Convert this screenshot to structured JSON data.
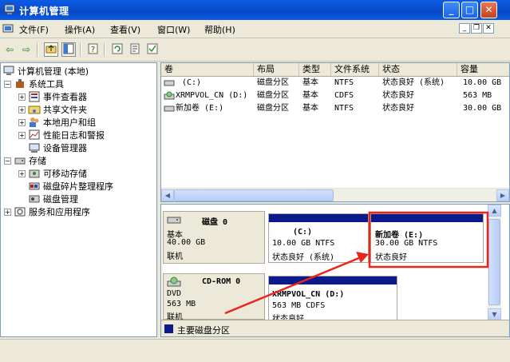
{
  "window": {
    "title": "计算机管理"
  },
  "menu": {
    "items": [
      "文件(F)",
      "操作(A)",
      "查看(V)",
      "窗口(W)",
      "帮助(H)"
    ]
  },
  "tree": {
    "root": "计算机管理 (本地)",
    "system_tools": "系统工具",
    "event_viewer": "事件查看器",
    "shared_folders": "共享文件夹",
    "local_users": "本地用户和组",
    "perf_logs": "性能日志和警报",
    "device_manager": "设备管理器",
    "storage": "存储",
    "removable": "可移动存储",
    "defrag": "磁盘碎片整理程序",
    "disk_mgmt": "磁盘管理",
    "services": "服务和应用程序"
  },
  "list": {
    "headers": [
      "卷",
      "布局",
      "类型",
      "文件系统",
      "状态",
      "容量"
    ],
    "rows": [
      {
        "vol": "(C:)",
        "layout": "磁盘分区",
        "type": "基本",
        "fs": "NTFS",
        "status": "状态良好 (系统)",
        "cap": "10.00 GB"
      },
      {
        "vol": "XRMPVOL_CN (D:)",
        "layout": "磁盘分区",
        "type": "基本",
        "fs": "CDFS",
        "status": "状态良好",
        "cap": "563 MB"
      },
      {
        "vol": "新加卷 (E:)",
        "layout": "磁盘分区",
        "type": "基本",
        "fs": "NTFS",
        "status": "状态良好",
        "cap": "30.00 GB"
      }
    ]
  },
  "disks": {
    "disk0": {
      "name": "磁盘 0",
      "kind": "基本",
      "size": "40.00 GB",
      "state": "联机"
    },
    "cdrom0": {
      "name": "CD-ROM 0",
      "kind": "DVD",
      "size": "563 MB",
      "state": "联机"
    },
    "partC": {
      "name": "(C:)",
      "detail": "10.00 GB NTFS",
      "status": "状态良好 (系统)"
    },
    "partE": {
      "name": "新加卷  (E:)",
      "detail": "30.00 GB NTFS",
      "status": "状态良好"
    },
    "partD": {
      "name": "XRMPVOL_CN  (D:)",
      "detail": "563 MB CDFS",
      "status": "状态良好"
    }
  },
  "legend": {
    "primary": "主要磁盘分区"
  },
  "colors": {
    "titlebar": "#0a5ce4",
    "partition_bar": "#0a1a8a",
    "highlight": "#e8261c"
  }
}
